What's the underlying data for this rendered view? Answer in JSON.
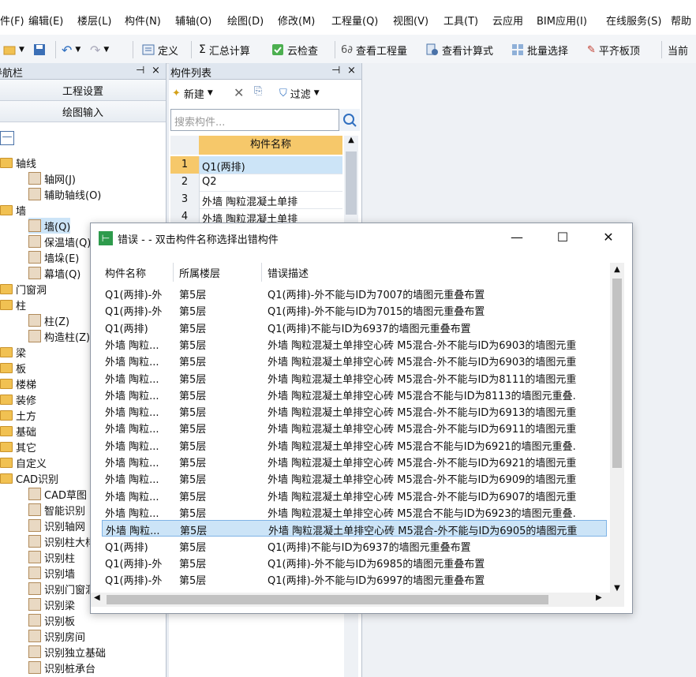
{
  "menu": [
    "件(F)",
    "编辑(E)",
    "楼层(L)",
    "构件(N)",
    "辅轴(O)",
    "绘图(D)",
    "修改(M)",
    "工程量(Q)",
    "视图(V)",
    "工具(T)",
    "云应用",
    "BIM应用(I)",
    "在线服务(S)",
    "帮助"
  ],
  "toolbar": {
    "define": "定义",
    "sum": "汇总计算",
    "cloud_check": "云检查",
    "view_qty": "查看工程量",
    "view_formula": "查看计算式",
    "batch_select": "批量选择",
    "align_slab": "平齐板顶",
    "current": "当前"
  },
  "nav": {
    "title": "导航栏",
    "project_settings": "工程设置",
    "drawing_input": "绘图输入",
    "tree": [
      "轴线",
      "轴网(J)",
      "辅助轴线(O)",
      "墙",
      "墙(Q)",
      "保温墙(Q)",
      "墙垛(E)",
      "幕墙(Q)",
      "门窗洞",
      "柱",
      "柱(Z)",
      "构造柱(Z)",
      "梁",
      "板",
      "楼梯",
      "装修",
      "土方",
      "基础",
      "其它",
      "自定义",
      "CAD识别",
      "CAD草图",
      "智能识别",
      "识别轴网",
      "识别柱大样",
      "识别柱",
      "识别墙",
      "识别门窗洞",
      "识别梁",
      "识别板",
      "识别房间",
      "识别独立基础",
      "识别桩承台"
    ]
  },
  "list": {
    "title": "构件列表",
    "new": "新建",
    "filter": "过滤",
    "search_placeholder": "搜索构件...",
    "col_name": "构件名称",
    "rows": [
      {
        "num": "1",
        "name": "Q1(两排)"
      },
      {
        "num": "2",
        "name": "Q2"
      },
      {
        "num": "3",
        "name": "外墙 陶粒混凝土单排"
      },
      {
        "num": "4",
        "name": "外墙 陶粒混凝土单排"
      }
    ]
  },
  "dialog": {
    "title": "错误 -  - 双击构件名称选择出错构件",
    "col_name": "构件名称",
    "col_floor": "所属楼层",
    "col_desc": "错误描述",
    "rows": [
      {
        "name": "Q1(两排)-外",
        "floor": "第5层",
        "desc": "Q1(两排)-外不能与ID为7007的墙图元重叠布置"
      },
      {
        "name": "Q1(两排)-外",
        "floor": "第5层",
        "desc": "Q1(两排)-外不能与ID为7015的墙图元重叠布置"
      },
      {
        "name": "Q1(两排)",
        "floor": "第5层",
        "desc": "Q1(两排)不能与ID为6937的墙图元重叠布置"
      },
      {
        "name": "外墙 陶粒...",
        "floor": "第5层",
        "desc": "外墙 陶粒混凝土单排空心砖 M5混合-外不能与ID为6903的墙图元重"
      },
      {
        "name": "外墙 陶粒...",
        "floor": "第5层",
        "desc": "外墙 陶粒混凝土单排空心砖 M5混合-外不能与ID为6903的墙图元重"
      },
      {
        "name": "外墙 陶粒...",
        "floor": "第5层",
        "desc": "外墙 陶粒混凝土单排空心砖 M5混合-外不能与ID为8111的墙图元重"
      },
      {
        "name": "外墙 陶粒...",
        "floor": "第5层",
        "desc": "外墙 陶粒混凝土单排空心砖 M5混合不能与ID为8113的墙图元重叠."
      },
      {
        "name": "外墙 陶粒...",
        "floor": "第5层",
        "desc": "外墙 陶粒混凝土单排空心砖 M5混合-外不能与ID为6913的墙图元重"
      },
      {
        "name": "外墙 陶粒...",
        "floor": "第5层",
        "desc": "外墙 陶粒混凝土单排空心砖 M5混合-外不能与ID为6911的墙图元重"
      },
      {
        "name": "外墙 陶粒...",
        "floor": "第5层",
        "desc": "外墙 陶粒混凝土单排空心砖 M5混合不能与ID为6921的墙图元重叠."
      },
      {
        "name": "外墙 陶粒...",
        "floor": "第5层",
        "desc": "外墙 陶粒混凝土单排空心砖 M5混合-外不能与ID为6921的墙图元重"
      },
      {
        "name": "外墙 陶粒...",
        "floor": "第5层",
        "desc": "外墙 陶粒混凝土单排空心砖 M5混合-外不能与ID为6909的墙图元重"
      },
      {
        "name": "外墙 陶粒...",
        "floor": "第5层",
        "desc": "外墙 陶粒混凝土单排空心砖 M5混合-外不能与ID为6907的墙图元重"
      },
      {
        "name": "外墙 陶粒...",
        "floor": "第5层",
        "desc": "外墙 陶粒混凝土单排空心砖 M5混合不能与ID为6923的墙图元重叠."
      },
      {
        "name": "外墙 陶粒...",
        "floor": "第5层",
        "desc": "外墙 陶粒混凝土单排空心砖 M5混合-外不能与ID为6905的墙图元重"
      },
      {
        "name": "Q1(两排)",
        "floor": "第5层",
        "desc": "Q1(两排)不能与ID为6937的墙图元重叠布置"
      },
      {
        "name": "Q1(两排)-外",
        "floor": "第5层",
        "desc": "Q1(两排)-外不能与ID为6985的墙图元重叠布置"
      },
      {
        "name": "Q1(两排)-外",
        "floor": "第5层",
        "desc": "Q1(两排)-外不能与ID为6997的墙图元重叠布置"
      }
    ]
  },
  "colors": {
    "accent": "#1e7bd8",
    "selected": "#cce4f7",
    "header": "#f6c86a"
  }
}
